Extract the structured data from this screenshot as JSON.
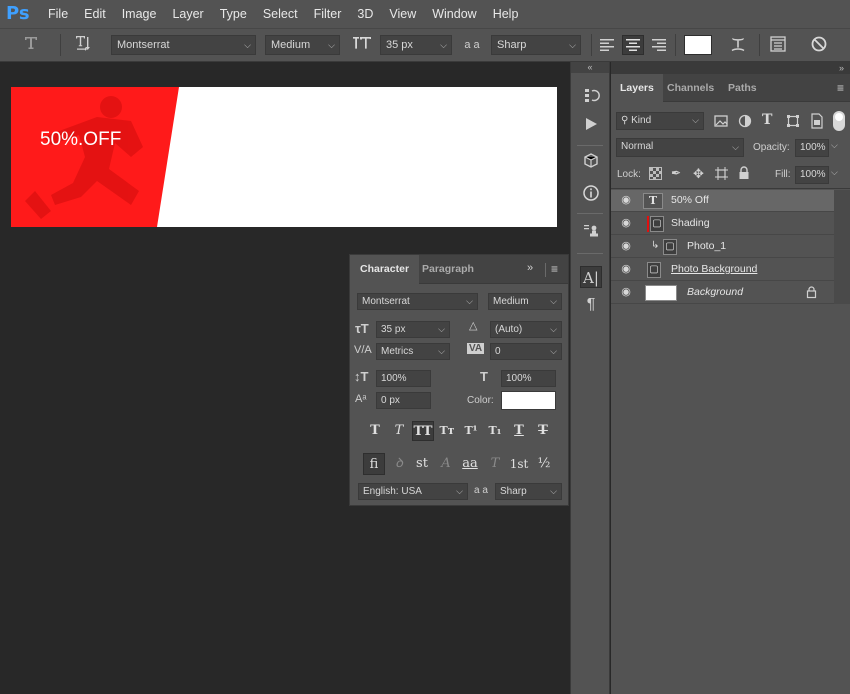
{
  "app": {
    "logo": "Ps"
  },
  "menu": [
    "File",
    "Edit",
    "Image",
    "Layer",
    "Type",
    "Select",
    "Filter",
    "3D",
    "View",
    "Window",
    "Help"
  ],
  "options_bar": {
    "font_family": "Montserrat",
    "font_style": "Medium",
    "font_size": "35 px",
    "antialias_glyph": "a a",
    "antialias": "Sharp",
    "text_color": "#ffffff",
    "icons": [
      "type-tool-icon",
      "toggle-orientation-icon",
      "font-size-icon",
      "antialias-icon",
      "align-left-icon",
      "align-center-icon",
      "align-right-icon",
      "color-swatch",
      "warp-text-icon",
      "character-panel-icon",
      "cancel-icon"
    ]
  },
  "document": {
    "banner_text": "50%.OFF",
    "accent_color": "#ff1a1a"
  },
  "character_panel": {
    "tabs": [
      "Character",
      "Paragraph"
    ],
    "font_family": "Montserrat",
    "font_style": "Medium",
    "font_size": "35 px",
    "leading": "(Auto)",
    "kerning": "Metrics",
    "tracking": "0",
    "vertical_scale": "100%",
    "horizontal_scale": "100%",
    "baseline_shift": "0 px",
    "color_label": "Color:",
    "color": "#ffffff",
    "type_buttons": [
      "T",
      "T",
      "TT",
      "Tт",
      "T¹",
      "T₁",
      "T",
      "T"
    ],
    "opentype_buttons": [
      "fi",
      "ꝺ",
      "st",
      "A",
      "aa",
      "T",
      "1st",
      "½"
    ],
    "language": "English: USA",
    "antialias_glyph": "a a",
    "antialias": "Sharp"
  },
  "layers_panel": {
    "tabs": [
      "Layers",
      "Channels",
      "Paths"
    ],
    "filter_label": "Kind",
    "blend_mode": "Normal",
    "opacity_label": "Opacity:",
    "opacity": "100%",
    "lock_label": "Lock:",
    "fill_label": "Fill:",
    "fill": "100%",
    "layers": [
      {
        "name": "50% Off",
        "type": "text",
        "selected": true
      },
      {
        "name": "Shading",
        "type": "smart",
        "selected": false
      },
      {
        "name": "Photo_1",
        "type": "smart-clipped",
        "selected": false
      },
      {
        "name": "Photo Background",
        "type": "smart",
        "selected": false
      },
      {
        "name": "Background",
        "type": "background",
        "selected": false
      }
    ]
  }
}
